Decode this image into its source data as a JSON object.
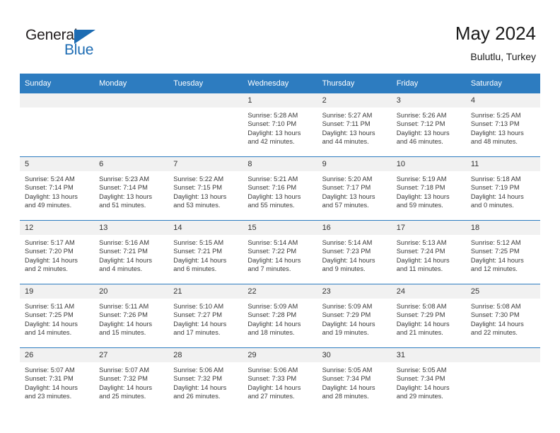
{
  "brand": {
    "name_top": "General",
    "name_bottom": "Blue",
    "accent_color": "#1d6cb3"
  },
  "header": {
    "title": "May 2024",
    "subtitle": "Bulutlu, Turkey",
    "header_bg": "#2d7cc0"
  },
  "weekday_headers": [
    "Sunday",
    "Monday",
    "Tuesday",
    "Wednesday",
    "Thursday",
    "Friday",
    "Saturday"
  ],
  "weeks": [
    [
      {
        "day": "",
        "sunrise": "",
        "sunset": "",
        "daylight_1": "",
        "daylight_2": "",
        "empty": true
      },
      {
        "day": "",
        "sunrise": "",
        "sunset": "",
        "daylight_1": "",
        "daylight_2": "",
        "empty": true
      },
      {
        "day": "",
        "sunrise": "",
        "sunset": "",
        "daylight_1": "",
        "daylight_2": "",
        "empty": true
      },
      {
        "day": "1",
        "sunrise": "Sunrise: 5:28 AM",
        "sunset": "Sunset: 7:10 PM",
        "daylight_1": "Daylight: 13 hours",
        "daylight_2": "and 42 minutes."
      },
      {
        "day": "2",
        "sunrise": "Sunrise: 5:27 AM",
        "sunset": "Sunset: 7:11 PM",
        "daylight_1": "Daylight: 13 hours",
        "daylight_2": "and 44 minutes."
      },
      {
        "day": "3",
        "sunrise": "Sunrise: 5:26 AM",
        "sunset": "Sunset: 7:12 PM",
        "daylight_1": "Daylight: 13 hours",
        "daylight_2": "and 46 minutes."
      },
      {
        "day": "4",
        "sunrise": "Sunrise: 5:25 AM",
        "sunset": "Sunset: 7:13 PM",
        "daylight_1": "Daylight: 13 hours",
        "daylight_2": "and 48 minutes."
      }
    ],
    [
      {
        "day": "5",
        "sunrise": "Sunrise: 5:24 AM",
        "sunset": "Sunset: 7:14 PM",
        "daylight_1": "Daylight: 13 hours",
        "daylight_2": "and 49 minutes."
      },
      {
        "day": "6",
        "sunrise": "Sunrise: 5:23 AM",
        "sunset": "Sunset: 7:14 PM",
        "daylight_1": "Daylight: 13 hours",
        "daylight_2": "and 51 minutes."
      },
      {
        "day": "7",
        "sunrise": "Sunrise: 5:22 AM",
        "sunset": "Sunset: 7:15 PM",
        "daylight_1": "Daylight: 13 hours",
        "daylight_2": "and 53 minutes."
      },
      {
        "day": "8",
        "sunrise": "Sunrise: 5:21 AM",
        "sunset": "Sunset: 7:16 PM",
        "daylight_1": "Daylight: 13 hours",
        "daylight_2": "and 55 minutes."
      },
      {
        "day": "9",
        "sunrise": "Sunrise: 5:20 AM",
        "sunset": "Sunset: 7:17 PM",
        "daylight_1": "Daylight: 13 hours",
        "daylight_2": "and 57 minutes."
      },
      {
        "day": "10",
        "sunrise": "Sunrise: 5:19 AM",
        "sunset": "Sunset: 7:18 PM",
        "daylight_1": "Daylight: 13 hours",
        "daylight_2": "and 59 minutes."
      },
      {
        "day": "11",
        "sunrise": "Sunrise: 5:18 AM",
        "sunset": "Sunset: 7:19 PM",
        "daylight_1": "Daylight: 14 hours",
        "daylight_2": "and 0 minutes."
      }
    ],
    [
      {
        "day": "12",
        "sunrise": "Sunrise: 5:17 AM",
        "sunset": "Sunset: 7:20 PM",
        "daylight_1": "Daylight: 14 hours",
        "daylight_2": "and 2 minutes."
      },
      {
        "day": "13",
        "sunrise": "Sunrise: 5:16 AM",
        "sunset": "Sunset: 7:21 PM",
        "daylight_1": "Daylight: 14 hours",
        "daylight_2": "and 4 minutes."
      },
      {
        "day": "14",
        "sunrise": "Sunrise: 5:15 AM",
        "sunset": "Sunset: 7:21 PM",
        "daylight_1": "Daylight: 14 hours",
        "daylight_2": "and 6 minutes."
      },
      {
        "day": "15",
        "sunrise": "Sunrise: 5:14 AM",
        "sunset": "Sunset: 7:22 PM",
        "daylight_1": "Daylight: 14 hours",
        "daylight_2": "and 7 minutes."
      },
      {
        "day": "16",
        "sunrise": "Sunrise: 5:14 AM",
        "sunset": "Sunset: 7:23 PM",
        "daylight_1": "Daylight: 14 hours",
        "daylight_2": "and 9 minutes."
      },
      {
        "day": "17",
        "sunrise": "Sunrise: 5:13 AM",
        "sunset": "Sunset: 7:24 PM",
        "daylight_1": "Daylight: 14 hours",
        "daylight_2": "and 11 minutes."
      },
      {
        "day": "18",
        "sunrise": "Sunrise: 5:12 AM",
        "sunset": "Sunset: 7:25 PM",
        "daylight_1": "Daylight: 14 hours",
        "daylight_2": "and 12 minutes."
      }
    ],
    [
      {
        "day": "19",
        "sunrise": "Sunrise: 5:11 AM",
        "sunset": "Sunset: 7:25 PM",
        "daylight_1": "Daylight: 14 hours",
        "daylight_2": "and 14 minutes."
      },
      {
        "day": "20",
        "sunrise": "Sunrise: 5:11 AM",
        "sunset": "Sunset: 7:26 PM",
        "daylight_1": "Daylight: 14 hours",
        "daylight_2": "and 15 minutes."
      },
      {
        "day": "21",
        "sunrise": "Sunrise: 5:10 AM",
        "sunset": "Sunset: 7:27 PM",
        "daylight_1": "Daylight: 14 hours",
        "daylight_2": "and 17 minutes."
      },
      {
        "day": "22",
        "sunrise": "Sunrise: 5:09 AM",
        "sunset": "Sunset: 7:28 PM",
        "daylight_1": "Daylight: 14 hours",
        "daylight_2": "and 18 minutes."
      },
      {
        "day": "23",
        "sunrise": "Sunrise: 5:09 AM",
        "sunset": "Sunset: 7:29 PM",
        "daylight_1": "Daylight: 14 hours",
        "daylight_2": "and 19 minutes."
      },
      {
        "day": "24",
        "sunrise": "Sunrise: 5:08 AM",
        "sunset": "Sunset: 7:29 PM",
        "daylight_1": "Daylight: 14 hours",
        "daylight_2": "and 21 minutes."
      },
      {
        "day": "25",
        "sunrise": "Sunrise: 5:08 AM",
        "sunset": "Sunset: 7:30 PM",
        "daylight_1": "Daylight: 14 hours",
        "daylight_2": "and 22 minutes."
      }
    ],
    [
      {
        "day": "26",
        "sunrise": "Sunrise: 5:07 AM",
        "sunset": "Sunset: 7:31 PM",
        "daylight_1": "Daylight: 14 hours",
        "daylight_2": "and 23 minutes."
      },
      {
        "day": "27",
        "sunrise": "Sunrise: 5:07 AM",
        "sunset": "Sunset: 7:32 PM",
        "daylight_1": "Daylight: 14 hours",
        "daylight_2": "and 25 minutes."
      },
      {
        "day": "28",
        "sunrise": "Sunrise: 5:06 AM",
        "sunset": "Sunset: 7:32 PM",
        "daylight_1": "Daylight: 14 hours",
        "daylight_2": "and 26 minutes."
      },
      {
        "day": "29",
        "sunrise": "Sunrise: 5:06 AM",
        "sunset": "Sunset: 7:33 PM",
        "daylight_1": "Daylight: 14 hours",
        "daylight_2": "and 27 minutes."
      },
      {
        "day": "30",
        "sunrise": "Sunrise: 5:05 AM",
        "sunset": "Sunset: 7:34 PM",
        "daylight_1": "Daylight: 14 hours",
        "daylight_2": "and 28 minutes."
      },
      {
        "day": "31",
        "sunrise": "Sunrise: 5:05 AM",
        "sunset": "Sunset: 7:34 PM",
        "daylight_1": "Daylight: 14 hours",
        "daylight_2": "and 29 minutes."
      },
      {
        "day": "",
        "sunrise": "",
        "sunset": "",
        "daylight_1": "",
        "daylight_2": "",
        "empty": true
      }
    ]
  ]
}
